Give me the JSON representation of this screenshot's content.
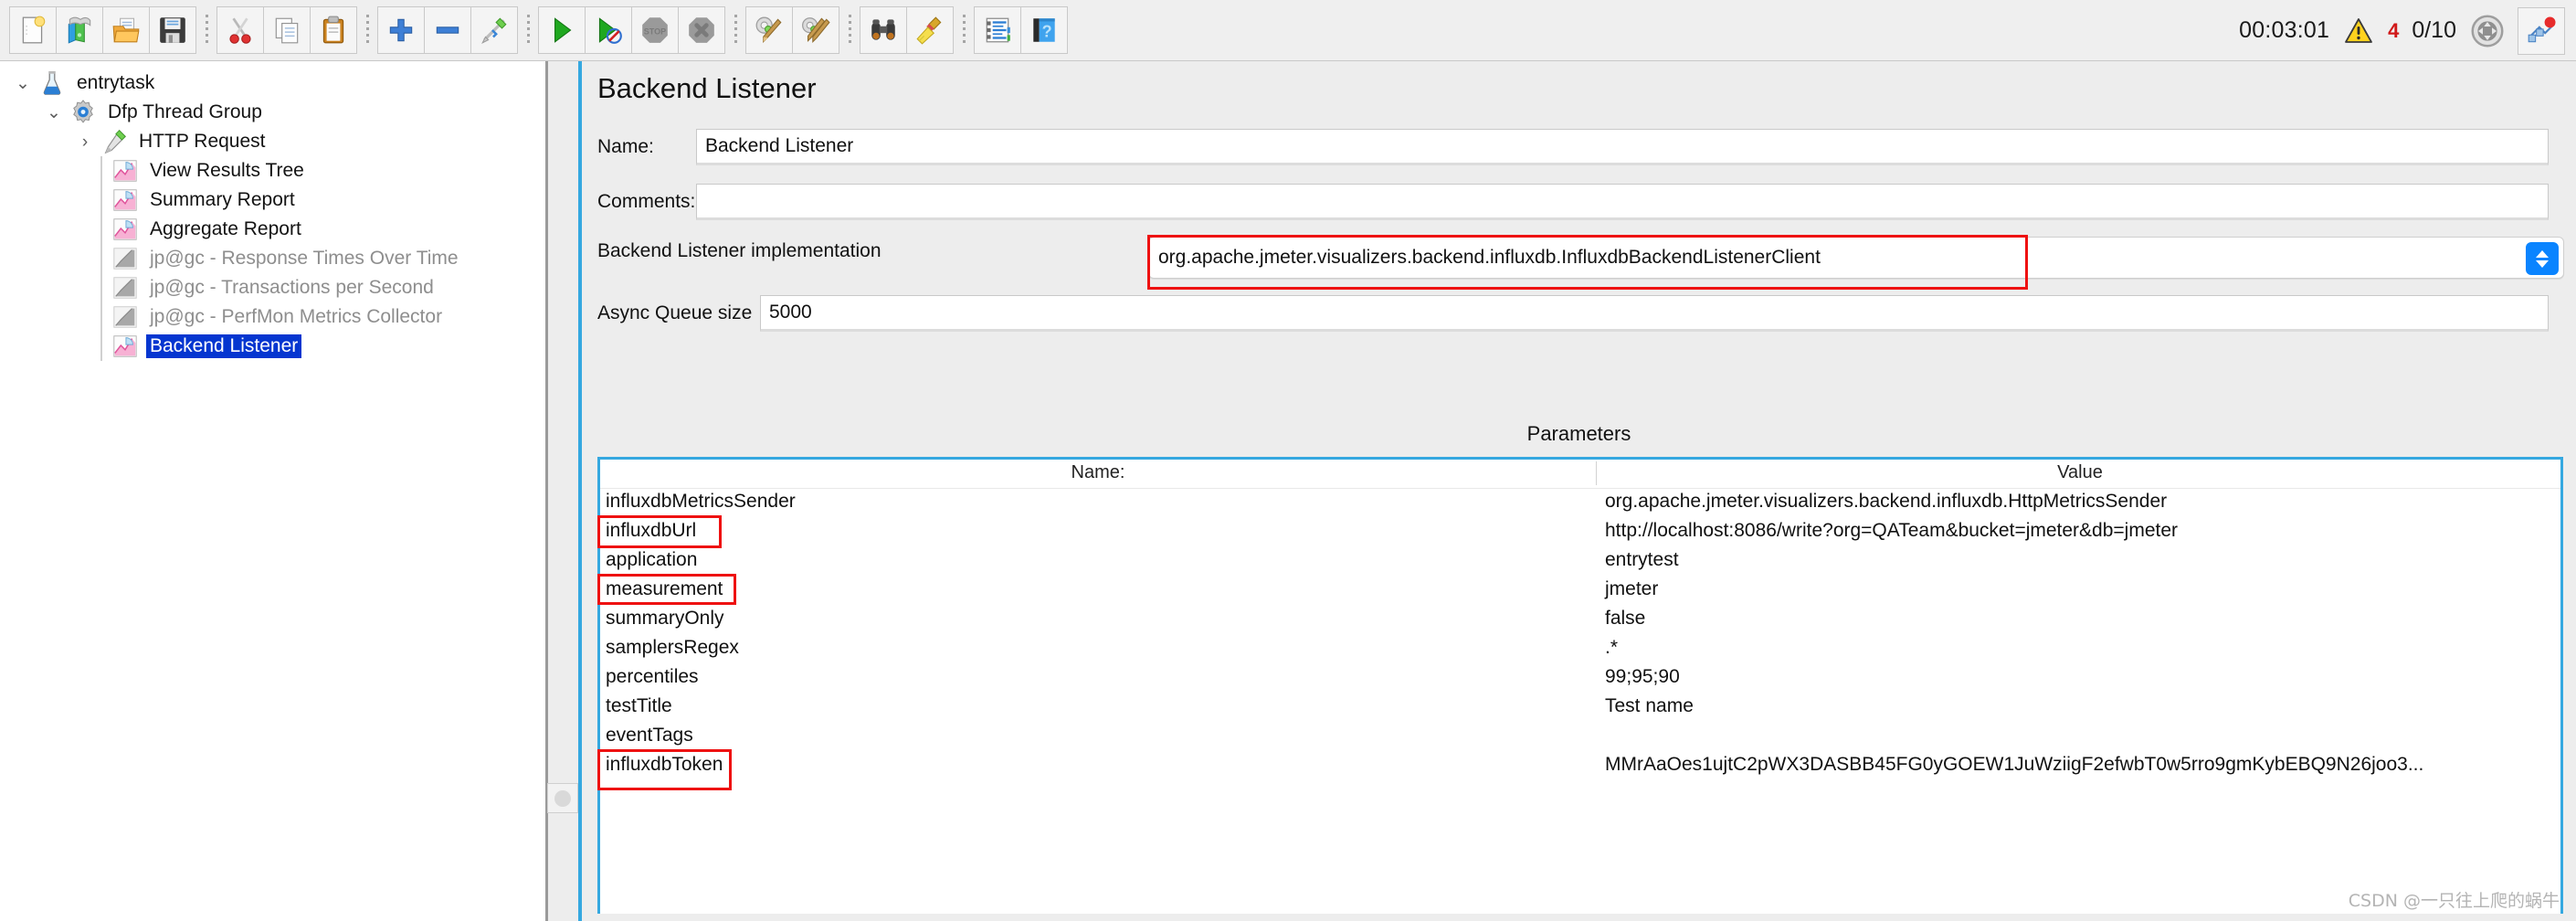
{
  "toolbar": {
    "buttons": [
      {
        "name": "new-button",
        "icon": "new-file-icon",
        "label": "New"
      },
      {
        "name": "templates-button",
        "icon": "templates-icon",
        "label": "Templates"
      },
      {
        "name": "open-button",
        "icon": "open-folder-icon",
        "label": "Open"
      },
      {
        "name": "save-button",
        "icon": "save-disk-icon",
        "label": "Save Test Plan"
      },
      {
        "name": "cut-button",
        "icon": "scissors-icon",
        "label": "Cut"
      },
      {
        "name": "copy-button",
        "icon": "copy-pages-icon",
        "label": "Copy"
      },
      {
        "name": "paste-button",
        "icon": "clipboard-icon",
        "label": "Paste"
      },
      {
        "name": "expand-all-button",
        "icon": "plus-icon",
        "label": "Expand All"
      },
      {
        "name": "collapse-all-button",
        "icon": "minus-icon",
        "label": "Collapse All"
      },
      {
        "name": "toggle-button",
        "icon": "toggle-pen-icon",
        "label": "Toggle"
      },
      {
        "name": "start-button",
        "icon": "green-play-icon",
        "label": "Start"
      },
      {
        "name": "start-no-pauses-button",
        "icon": "green-play-nopause-icon",
        "label": "Start no pauses"
      },
      {
        "name": "stop-button",
        "icon": "stop-sign-icon",
        "label": "Stop"
      },
      {
        "name": "shutdown-button",
        "icon": "shutdown-x-icon",
        "label": "Shutdown"
      },
      {
        "name": "clear-button",
        "icon": "gear-broom-icon",
        "label": "Clear"
      },
      {
        "name": "clear-all-button",
        "icon": "gear-broom-double-icon",
        "label": "Clear All"
      },
      {
        "name": "search-button",
        "icon": "binoculars-icon",
        "label": "Search"
      },
      {
        "name": "reset-search-button",
        "icon": "yellow-broom-icon",
        "label": "Reset Search"
      },
      {
        "name": "function-helper-button",
        "icon": "list-lines-icon",
        "label": "Function Helper Dialog"
      },
      {
        "name": "help-button",
        "icon": "blue-book-question-icon",
        "label": "Help"
      }
    ],
    "status": {
      "elapsed": "00:03:01",
      "warning_count": "4",
      "threads": "0/10",
      "warning_icon": "warning-triangle-icon",
      "throughput_icon": "throughput-gauge-icon",
      "remote_icon": "remote-engines-icon",
      "warning_color": "#d01818"
    }
  },
  "tree": {
    "items": [
      {
        "label": "entrytask",
        "icon": "test-plan-flask-icon",
        "indent": 0,
        "twisty": "expanded",
        "state": "normal"
      },
      {
        "label": "Dfp Thread Group",
        "icon": "thread-group-gear-icon",
        "indent": 1,
        "twisty": "expanded",
        "state": "normal"
      },
      {
        "label": "HTTP Request",
        "icon": "http-sampler-pen-icon",
        "indent": 2,
        "twisty": "collapsed",
        "state": "normal"
      },
      {
        "label": "View Results Tree",
        "icon": "listener-chart-icon",
        "indent": 2,
        "twisty": "none",
        "state": "normal"
      },
      {
        "label": "Summary Report",
        "icon": "listener-chart-icon",
        "indent": 2,
        "twisty": "none",
        "state": "normal"
      },
      {
        "label": "Aggregate Report",
        "icon": "listener-chart-icon",
        "indent": 2,
        "twisty": "none",
        "state": "normal"
      },
      {
        "label": "jp@gc - Response Times Over Time",
        "icon": "listener-chart-gray-icon",
        "indent": 2,
        "twisty": "none",
        "state": "disabled"
      },
      {
        "label": "jp@gc - Transactions per Second",
        "icon": "listener-chart-gray-icon",
        "indent": 2,
        "twisty": "none",
        "state": "disabled"
      },
      {
        "label": "jp@gc - PerfMon Metrics Collector",
        "icon": "listener-chart-gray-icon",
        "indent": 2,
        "twisty": "none",
        "state": "disabled"
      },
      {
        "label": "Backend Listener",
        "icon": "listener-chart-icon",
        "indent": 2,
        "twisty": "none",
        "state": "selected"
      }
    ],
    "selection_color": "#0536d0"
  },
  "main": {
    "title": "Backend Listener",
    "name_label": "Name:",
    "name_value": "Backend Listener",
    "comments_label": "Comments:",
    "comments_value": "",
    "impl_label": "Backend Listener implementation",
    "impl_value": "org.apache.jmeter.visualizers.backend.influxdb.InfluxdbBackendListenerClient",
    "queue_label": "Async Queue size",
    "queue_value": "5000",
    "params_title": "Parameters",
    "col_name": "Name:",
    "col_value": "Value",
    "highlight_color": "#ee1111",
    "table_border_color": "#35a8e0",
    "parameters": [
      {
        "name": "influxdbMetricsSender",
        "value": "org.apache.jmeter.visualizers.backend.influxdb.HttpMetricsSender",
        "highlighted": false
      },
      {
        "name": "influxdbUrl",
        "value": "http://localhost:8086/write?org=QATeam&bucket=jmeter&db=jmeter",
        "highlighted": true
      },
      {
        "name": "application",
        "value": "entrytest",
        "highlighted": false
      },
      {
        "name": "measurement",
        "value": "jmeter",
        "highlighted": true
      },
      {
        "name": "summaryOnly",
        "value": "false",
        "highlighted": false
      },
      {
        "name": "samplersRegex",
        "value": ".*",
        "highlighted": false
      },
      {
        "name": "percentiles",
        "value": "99;95;90",
        "highlighted": false
      },
      {
        "name": "testTitle",
        "value": "Test name",
        "highlighted": false
      },
      {
        "name": "eventTags",
        "value": "",
        "highlighted": false
      },
      {
        "name": "influxdbToken",
        "value": "MMrAaOes1ujtC2pWX3DASBB45FG0yGOEW1JuWziigF2efwbT0w5rro9gmKybEBQ9N26joo3...",
        "highlighted": true
      }
    ]
  },
  "watermark": "CSDN @一只往上爬的蜗牛"
}
